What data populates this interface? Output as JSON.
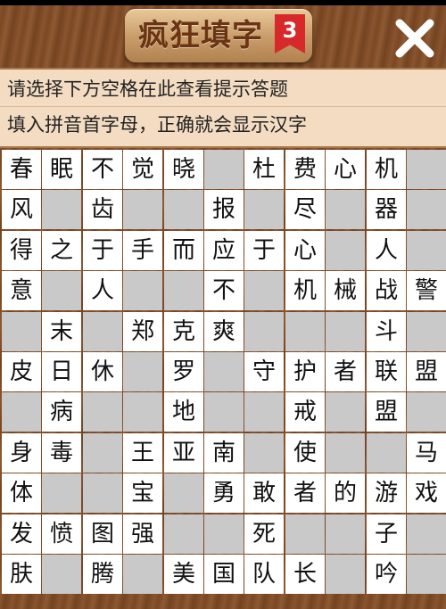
{
  "header": {
    "title": "疯狂填字",
    "level": "3",
    "close_icon": "close-x-icon"
  },
  "hint": {
    "line1": "请选择下方空格在此查看提示答题",
    "line2": "填入拼音首字母，正确就会显示汉字"
  },
  "grid": {
    "cols": 11,
    "rows": 11,
    "cells": [
      [
        "春",
        "眠",
        "不",
        "觉",
        "晓",
        "",
        "杜",
        "费",
        "心",
        "机",
        ""
      ],
      [
        "风",
        "",
        "齿",
        "",
        "",
        "报",
        "",
        "尽",
        "",
        "器",
        ""
      ],
      [
        "得",
        "之",
        "于",
        "手",
        "而",
        "应",
        "于",
        "心",
        "",
        "人",
        ""
      ],
      [
        "意",
        "",
        "人",
        "",
        "",
        "不",
        "",
        "机",
        "械",
        "战",
        "警"
      ],
      [
        "",
        "末",
        "",
        "郑",
        "克",
        "爽",
        "",
        "",
        "",
        "斗",
        ""
      ],
      [
        "皮",
        "日",
        "休",
        "",
        "罗",
        "",
        "守",
        "护",
        "者",
        "联",
        "盟"
      ],
      [
        "",
        "病",
        "",
        "",
        "地",
        "",
        "",
        "戒",
        "",
        "盟",
        ""
      ],
      [
        "身",
        "毒",
        "",
        "王",
        "亚",
        "南",
        "",
        "使",
        "",
        "",
        "马"
      ],
      [
        "体",
        "",
        "",
        "宝",
        "",
        "勇",
        "敢",
        "者",
        "的",
        "游",
        "戏"
      ],
      [
        "发",
        "愤",
        "图",
        "强",
        "",
        "",
        "死",
        "",
        "",
        "子",
        ""
      ],
      [
        "肤",
        "",
        "腾",
        "",
        "美",
        "国",
        "队",
        "长",
        "",
        "吟",
        ""
      ]
    ],
    "colors": {
      "filled": "#ffffff",
      "empty": "#c9c9c9",
      "grid_line": "#8a5a33"
    }
  }
}
